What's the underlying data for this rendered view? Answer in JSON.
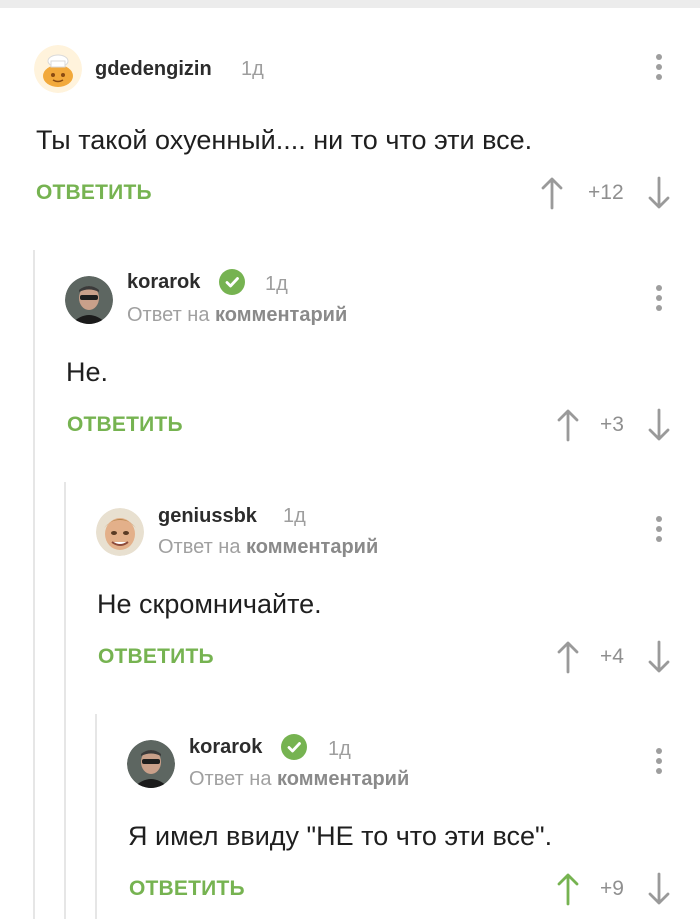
{
  "comments": [
    {
      "username": "gdedengizin",
      "time": "1д",
      "text": "Ты такой охуенный.... ни то что эти все.",
      "reply_label": "ОТВЕТИТЬ",
      "rating": "+12",
      "avatar": "cookie-chef-avatar"
    },
    {
      "username": "korarok",
      "verified": true,
      "time": "1д",
      "reply_to_prefix": "Ответ на",
      "reply_to_link": "комментарий",
      "text": "Не.",
      "reply_label": "ОТВЕТИТЬ",
      "rating": "+3",
      "avatar": "man-sunglasses-avatar"
    },
    {
      "username": "geniussbk",
      "time": "1д",
      "reply_to_prefix": "Ответ на",
      "reply_to_link": "комментарий",
      "text": "Не скромничайте.",
      "reply_label": "ОТВЕТИТЬ",
      "rating": "+4",
      "avatar": "boy-face-avatar"
    },
    {
      "username": "korarok",
      "verified": true,
      "time": "1д",
      "reply_to_prefix": "Ответ на",
      "reply_to_link": "комментарий",
      "text": "Я имел ввиду \"НЕ то что эти все\".",
      "reply_label": "ОТВЕТИТЬ",
      "rating": "+9",
      "upvoted": true,
      "avatar": "man-sunglasses-avatar"
    }
  ],
  "colors": {
    "accent": "#76b351",
    "muted": "#9e9e9e",
    "thread_line": "#e6e6e6",
    "verified": "#76b351"
  }
}
